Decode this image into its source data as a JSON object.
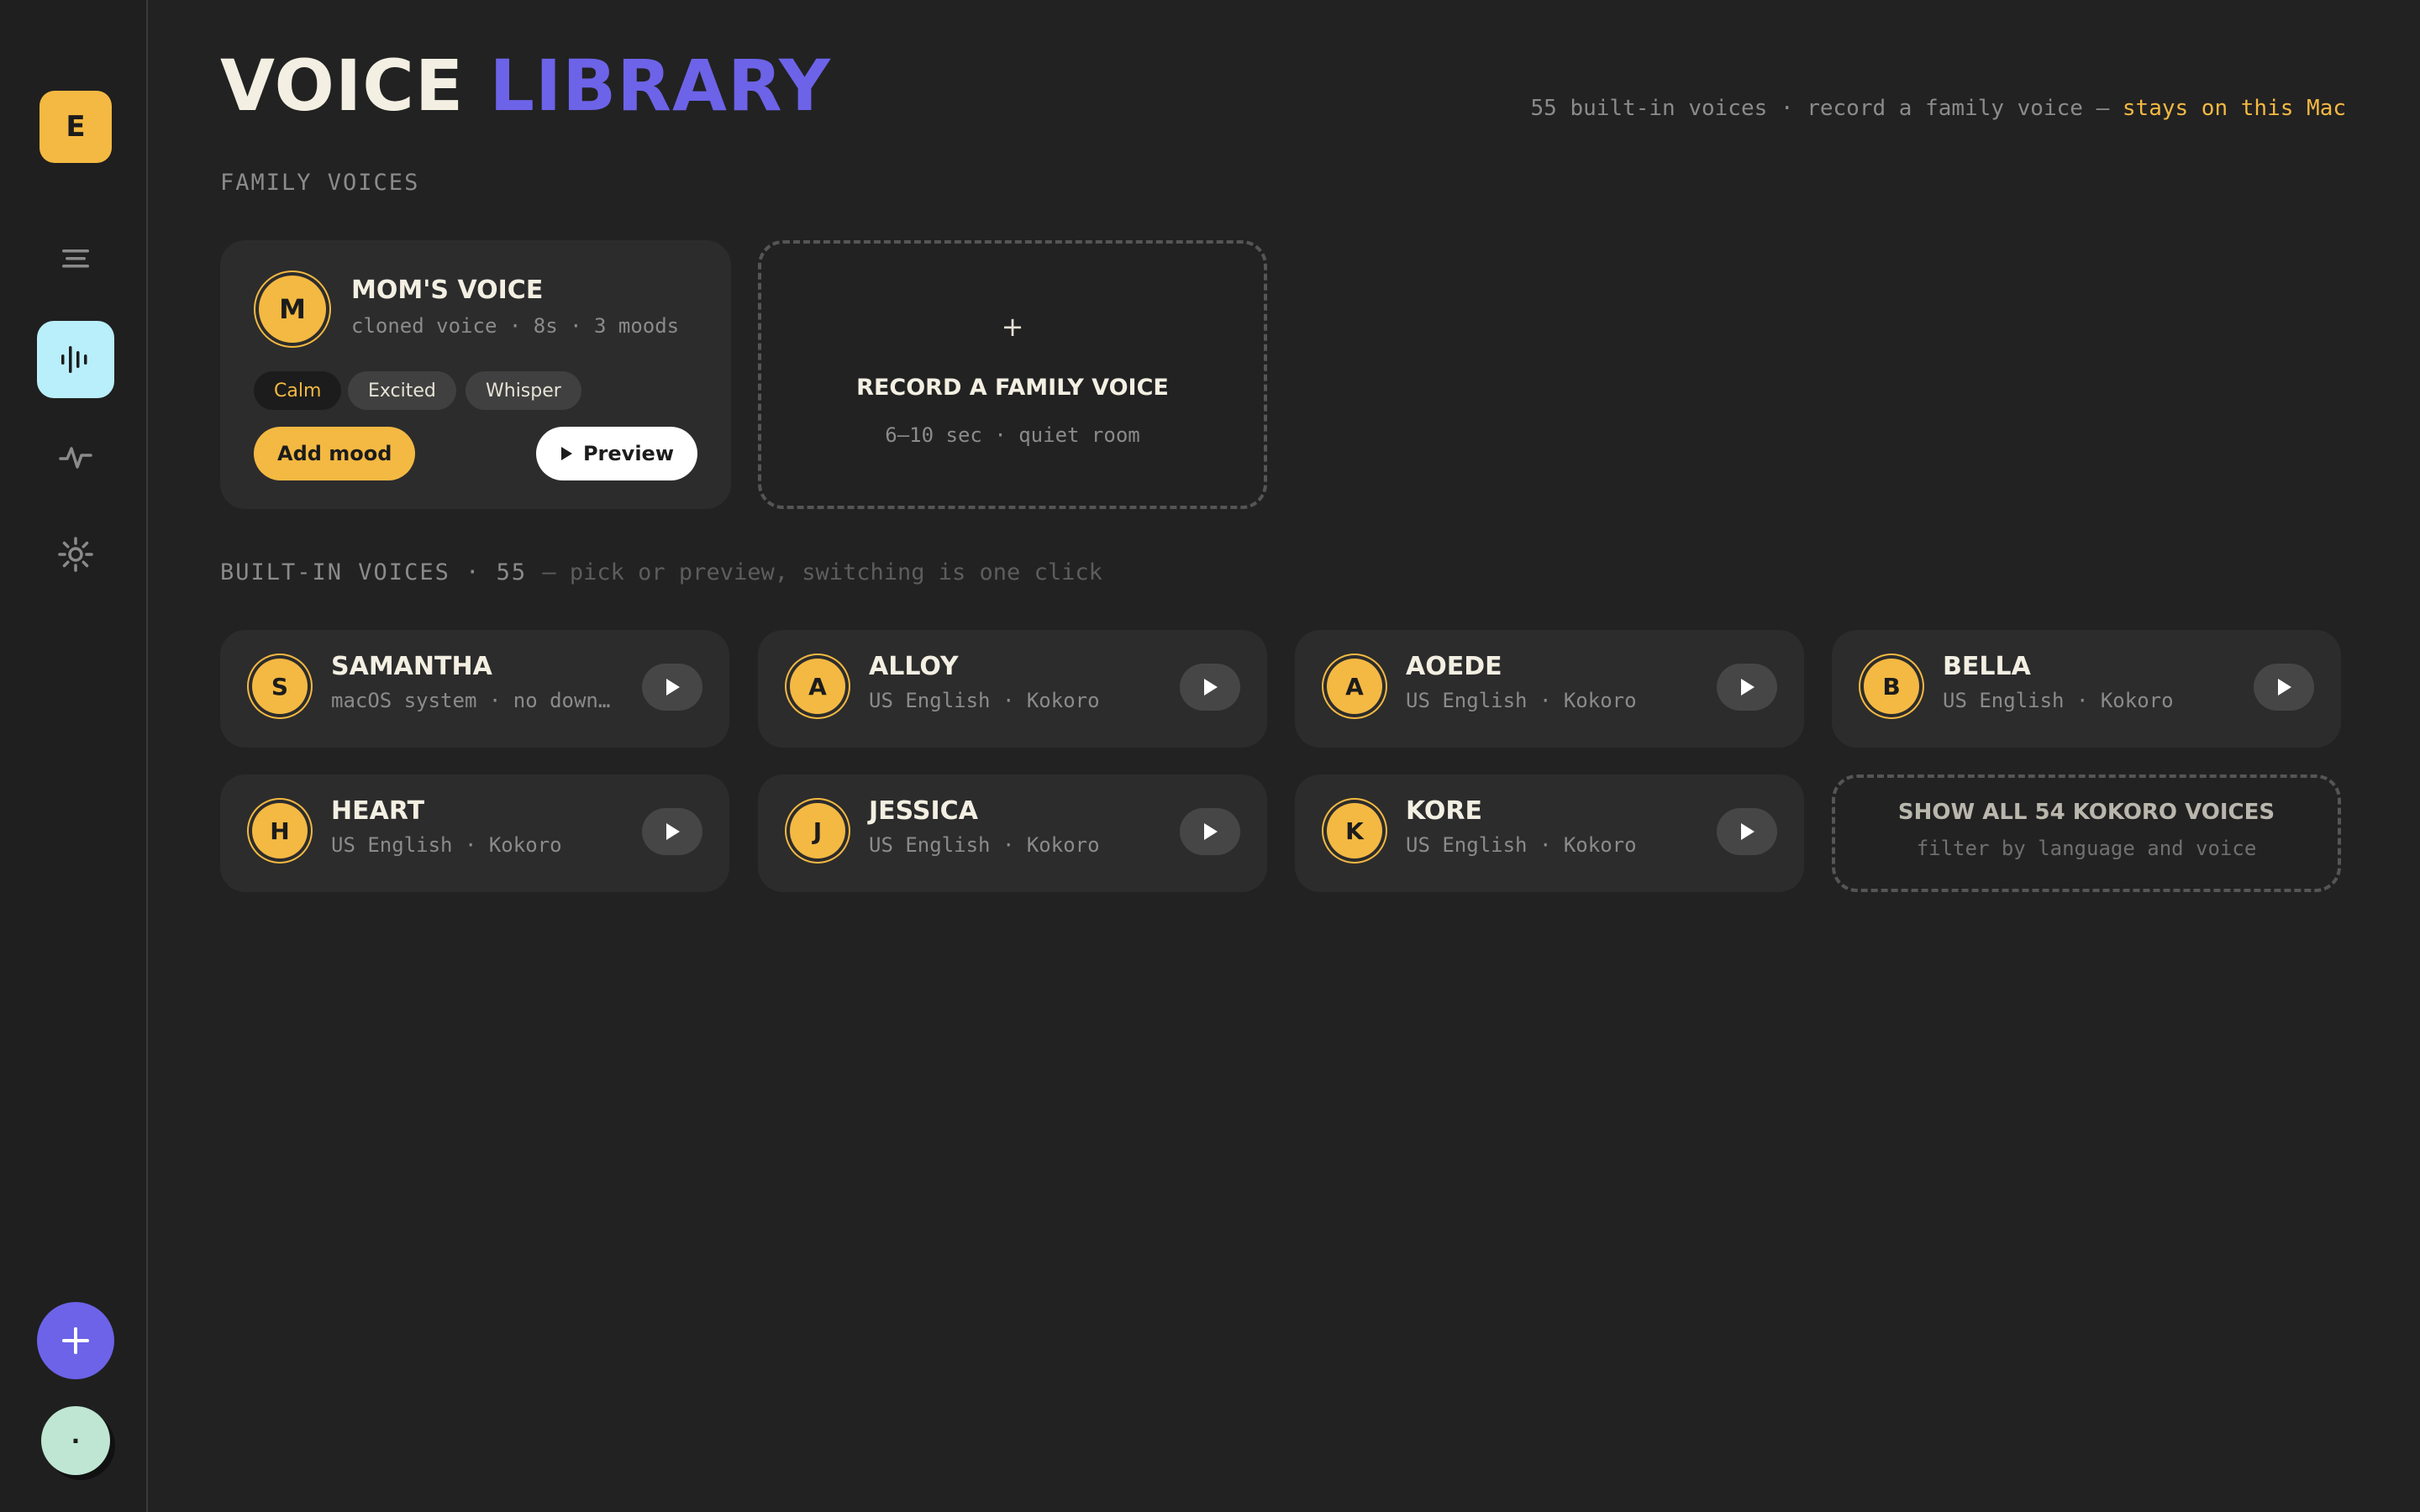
{
  "sidebar": {
    "logo_letter": "E",
    "nav": [
      {
        "name": "list-icon"
      },
      {
        "name": "waveform-icon",
        "active": true
      },
      {
        "name": "activity-icon"
      },
      {
        "name": "gear-icon"
      }
    ],
    "fab": {
      "icon": "plus-icon"
    },
    "avatar_text": "·"
  },
  "header": {
    "title_part1": "VOICE",
    "title_part2": "LIBRARY",
    "note_prefix": "55 built-in voices · record a family voice —",
    "note_highlight": "stays on this Mac"
  },
  "family": {
    "section_label": "FAMILY VOICES",
    "card": {
      "initial": "M",
      "name": "MOM'S VOICE",
      "subtitle": "cloned voice · 8s · 3 moods",
      "moods": [
        "Calm",
        "Excited",
        "Whisper"
      ],
      "selected_mood": "Calm",
      "add_label": "Add mood",
      "preview_label": "Preview"
    },
    "record": {
      "plus": "+",
      "title": "RECORD A FAMILY VOICE",
      "subtitle": "6–10 sec · quiet room"
    }
  },
  "builtin": {
    "section_label": "BUILT-IN VOICES · 55",
    "section_hint": "— pick or preview, switching is one click",
    "voices": [
      {
        "initial": "S",
        "name": "SAMANTHA",
        "subtitle": "macOS system · no download"
      },
      {
        "initial": "A",
        "name": "ALLOY",
        "subtitle": "US English · Kokoro"
      },
      {
        "initial": "A",
        "name": "AOEDE",
        "subtitle": "US English · Kokoro"
      },
      {
        "initial": "B",
        "name": "BELLA",
        "subtitle": "US English · Kokoro"
      },
      {
        "initial": "H",
        "name": "HEART",
        "subtitle": "US English · Kokoro"
      },
      {
        "initial": "J",
        "name": "JESSICA",
        "subtitle": "US English · Kokoro"
      },
      {
        "initial": "K",
        "name": "KORE",
        "subtitle": "US English · Kokoro"
      }
    ],
    "show_all": {
      "title": "SHOW ALL 54 KOKORO VOICES",
      "subtitle": "filter by language and voice"
    }
  },
  "colors": {
    "background": "#222222",
    "accent_yellow": "#f4b942",
    "accent_purple": "#6c63e8",
    "active_nav": "#b9eefb"
  }
}
